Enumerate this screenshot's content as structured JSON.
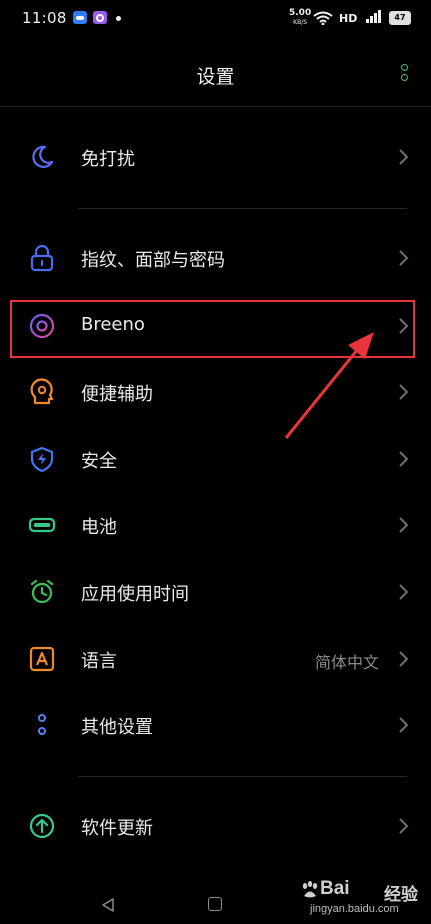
{
  "status_bar": {
    "time": "11:08",
    "net_speed": "5.00",
    "net_speed_unit": "KB/S",
    "network_type": "HD",
    "battery": "47"
  },
  "header": {
    "title": "设置",
    "more_icon": "more-vertical-icon"
  },
  "colors": {
    "background": "#000000",
    "accent_green": "#37c67a",
    "highlight_red": "#e8343a",
    "chevron": "#6f6f6f"
  },
  "settings_items": [
    {
      "id": "dnd",
      "label": "免打扰",
      "icon": "moon-icon",
      "value": ""
    },
    {
      "id": "security-lock",
      "label": "指纹、面部与密码",
      "icon": "lock-icon",
      "value": ""
    },
    {
      "id": "breeno",
      "label": "Breeno",
      "icon": "breeno-ring-icon",
      "value": ""
    },
    {
      "id": "accessibility",
      "label": "便捷辅助",
      "icon": "head-gear-icon",
      "value": ""
    },
    {
      "id": "safety",
      "label": "安全",
      "icon": "shield-bolt-icon",
      "value": ""
    },
    {
      "id": "battery",
      "label": "电池",
      "icon": "battery-icon",
      "value": ""
    },
    {
      "id": "screen-time",
      "label": "应用使用时间",
      "icon": "alarm-clock-icon",
      "value": ""
    },
    {
      "id": "language",
      "label": "语言",
      "icon": "letter-a-icon",
      "value": "简体中文"
    },
    {
      "id": "other-settings",
      "label": "其他设置",
      "icon": "dots-vertical-icon",
      "value": ""
    },
    {
      "id": "software-update",
      "label": "软件更新",
      "icon": "arrow-up-circle-icon",
      "value": ""
    }
  ],
  "watermark": {
    "brand": "Bai",
    "brand_suffix": "经验",
    "url": "jingyan.baidu.com"
  }
}
